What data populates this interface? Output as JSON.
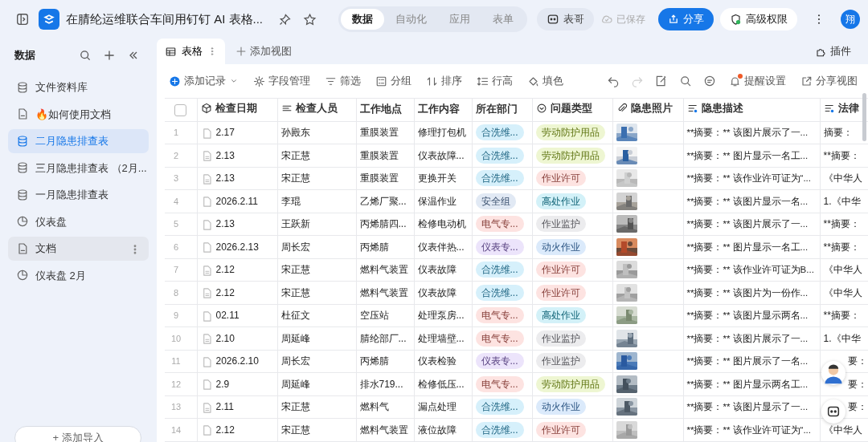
{
  "top_bar": {
    "title": "在腈纶运维联合车间用钉钉 AI 表格...",
    "mode_tabs": [
      {
        "label": "数据",
        "selected": true
      },
      {
        "label": "自动化",
        "selected": false
      },
      {
        "label": "应用",
        "selected": false
      },
      {
        "label": "表单",
        "selected": false
      }
    ],
    "assistant_button": "表哥",
    "save_status": "已保存",
    "share_button": "分享",
    "permission_button": "高级权限",
    "user_avatar": "翔"
  },
  "sidebar": {
    "heading": "数据",
    "items": [
      {
        "label": "文件资料库",
        "kind": "table",
        "selected": false,
        "hovered": false
      },
      {
        "label": "🔥如何使用文档",
        "kind": "doc",
        "selected": false,
        "hovered": false
      },
      {
        "label": "二月隐患排查表",
        "kind": "table",
        "selected": true,
        "hovered": false
      },
      {
        "label": "三月隐患排查表 （2月...",
        "kind": "table",
        "selected": false,
        "hovered": false
      },
      {
        "label": "一月隐患排查表",
        "kind": "table",
        "selected": false,
        "hovered": false
      },
      {
        "label": "仪表盘",
        "kind": "dashboard",
        "selected": false,
        "hovered": false
      },
      {
        "label": "文档",
        "kind": "doc",
        "selected": false,
        "hovered": true
      },
      {
        "label": "仪表盘 2月",
        "kind": "dashboard",
        "selected": false,
        "hovered": false
      }
    ],
    "add_button": "+ 添加导入"
  },
  "view_tabs": [
    {
      "label": "表格",
      "selected": true
    }
  ],
  "add_view_button": "添加视图",
  "plugin_button": "插件",
  "toolbar": {
    "left": [
      {
        "label": "添加记录",
        "kind": "add"
      },
      {
        "label": "字段管理",
        "kind": "fields"
      },
      {
        "label": "筛选",
        "kind": "filter"
      },
      {
        "label": "分组",
        "kind": "group"
      },
      {
        "label": "排序",
        "kind": "sort"
      },
      {
        "label": "行高",
        "kind": "row_height"
      },
      {
        "label": "填色",
        "kind": "fill"
      }
    ],
    "right_icons": [
      {
        "kind": "undo",
        "disabled": false
      },
      {
        "kind": "redo",
        "disabled": true
      },
      {
        "kind": "edit",
        "disabled": false
      },
      {
        "kind": "search",
        "disabled": false
      },
      {
        "kind": "comment",
        "disabled": false
      }
    ],
    "reminder_button": {
      "label": "提醒设置",
      "badge": true
    },
    "share_view_button": "分享视图"
  },
  "table": {
    "select_all": {
      "checked": false
    },
    "columns": [
      {
        "label": "检查日期",
        "kind": "date"
      },
      {
        "label": "检查人员",
        "kind": "text"
      },
      {
        "label": "工作地点",
        "kind": "plain"
      },
      {
        "label": "工作内容",
        "kind": "plain"
      },
      {
        "label": "所在部门",
        "kind": "plain"
      },
      {
        "label": "问题类型",
        "kind": "select"
      },
      {
        "label": "隐患照片",
        "kind": "attachment"
      },
      {
        "label": "隐患描述",
        "kind": "ai_text"
      },
      {
        "label": "法律",
        "kind": "ai_text"
      }
    ],
    "rows": [
      {
        "number": "1",
        "date": {
          "text": "2.17",
          "has_doc": false
        },
        "person": "孙殿东",
        "location": "重膜装置",
        "content": "修理打包机",
        "department": {
          "label": "合洗维...",
          "color": "#d6f0fb"
        },
        "issue_type": {
          "label": "劳动防护用品",
          "color": "#eef6d2"
        },
        "description": "**摘要：** 该图片展示了一...",
        "law": {
          "text": "摘要：",
          "covered": false
        }
      },
      {
        "number": "2",
        "date": {
          "text": "2.13",
          "has_doc": true
        },
        "person": "宋正慧",
        "location": "重膜装置",
        "content": "仪表故障...",
        "department": {
          "label": "合洗维...",
          "color": "#d6f0fb"
        },
        "issue_type": {
          "label": "劳动防护用品",
          "color": "#eef6d2"
        },
        "description": "**摘要：** 图片显示一名工...",
        "law": {
          "text": "**摘要：",
          "covered": false
        }
      },
      {
        "number": "3",
        "date": {
          "text": "2.13",
          "has_doc": true
        },
        "person": "宋正慧",
        "location": "重膜装置",
        "content": "更换开关",
        "department": {
          "label": "合洗维...",
          "color": "#d6f0fb"
        },
        "issue_type": {
          "label": "作业许可",
          "color": "#fde3e1"
        },
        "description": "**摘要：** 该作业许可证为“...",
        "law": {
          "text": "《中华人",
          "covered": false
        }
      },
      {
        "number": "4",
        "date": {
          "text": "2026.2.11",
          "has_doc": false
        },
        "person": "李琨",
        "location": "乙烯厂聚...",
        "content": "保温作业",
        "department": {
          "label": "安全组",
          "color": "#e1e9f4"
        },
        "issue_type": {
          "label": "高处作业",
          "color": "#d3f1f8"
        },
        "description": "**摘要：** 该图片显示一名...",
        "law": {
          "text": "1.《中华",
          "covered": false
        }
      },
      {
        "number": "5",
        "date": {
          "text": "2.13",
          "has_doc": false
        },
        "person": "王跃新",
        "location": "丙烯腈四...",
        "content": "检修电动机",
        "department": {
          "label": "电气专...",
          "color": "#fde3e1"
        },
        "issue_type": {
          "label": "作业监护",
          "color": "#ececee"
        },
        "description": "**摘要：** 该图片展示了一...",
        "law": {
          "text": "**摘要：",
          "covered": false
        }
      },
      {
        "number": "6",
        "date": {
          "text": "2026.2.13",
          "has_doc": false
        },
        "person": "周长宏",
        "location": "丙烯腈",
        "content": "仪表伴热...",
        "department": {
          "label": "仪表专...",
          "color": "#ece4fb"
        },
        "issue_type": {
          "label": "动火作业",
          "color": "#dbeafb"
        },
        "description": "**摘要：** 图片显示一名工...",
        "law": {
          "text": "**摘要：",
          "covered": false
        }
      },
      {
        "number": "7",
        "date": {
          "text": "2.12",
          "has_doc": true
        },
        "person": "宋正慧",
        "location": "燃料气装置",
        "content": "仪表故障",
        "department": {
          "label": "合洗维...",
          "color": "#d6f0fb"
        },
        "issue_type": {
          "label": "作业许可",
          "color": "#fde3e1"
        },
        "description": "**摘要：** 该作业许可证为B...",
        "law": {
          "text": "《中华人",
          "covered": false
        }
      },
      {
        "number": "8",
        "date": {
          "text": "2.12",
          "has_doc": true
        },
        "person": "宋正慧",
        "location": "燃料气装置",
        "content": "仪表故障",
        "department": {
          "label": "合洗维...",
          "color": "#d6f0fb"
        },
        "issue_type": {
          "label": "作业许可",
          "color": "#fde3e1"
        },
        "description": "**摘要：** 该图片为一份作...",
        "law": {
          "text": "《中华人",
          "covered": false
        }
      },
      {
        "number": "9",
        "date": {
          "text": "02.11",
          "has_doc": false
        },
        "person": "杜征文",
        "location": "空压站",
        "content": "处理泵房...",
        "department": {
          "label": "电气专...",
          "color": "#fde3e1"
        },
        "issue_type": {
          "label": "高处作业",
          "color": "#d3f1f8"
        },
        "description": "**摘要：** 该图片显示两名...",
        "law": {
          "text": "**摘要：",
          "covered": false
        }
      },
      {
        "number": "10",
        "date": {
          "text": "2.10",
          "has_doc": true
        },
        "person": "周延峰",
        "location": "腈纶部厂...",
        "content": "处理墙壁...",
        "department": {
          "label": "电气专...",
          "color": "#fde3e1"
        },
        "issue_type": {
          "label": "作业监护",
          "color": "#ececee"
        },
        "description": "**摘要：** 该图片展示了一...",
        "law": {
          "text": "1.《中华",
          "covered": false
        }
      },
      {
        "number": "11",
        "date": {
          "text": "2026.2.10",
          "has_doc": false
        },
        "person": "周长宏",
        "location": "丙烯腈",
        "content": "仪表检验",
        "department": {
          "label": "仪表专...",
          "color": "#ece4fb"
        },
        "issue_type": {
          "label": "作业监护",
          "color": "#ececee"
        },
        "description": "**摘要：** 图片展示了一名...",
        "law": {
          "text": "要：",
          "covered": true
        }
      },
      {
        "number": "12",
        "date": {
          "text": "2.9",
          "has_doc": false
        },
        "person": "周延峰",
        "location": "排水719...",
        "content": "检修低压...",
        "department": {
          "label": "电气专...",
          "color": "#fde3e1"
        },
        "issue_type": {
          "label": "劳动防护用品",
          "color": "#eef6d2"
        },
        "description": "**摘要：** 图片显示两名工...",
        "law": {
          "text": "要：",
          "covered": true
        }
      },
      {
        "number": "13",
        "date": {
          "text": "2.11",
          "has_doc": true
        },
        "person": "宋正慧",
        "location": "燃料气",
        "content": "漏点处理",
        "department": {
          "label": "合洗维...",
          "color": "#d6f0fb"
        },
        "issue_type": {
          "label": "动火作业",
          "color": "#dbeafb"
        },
        "description": "**摘要：** 该图片显示了一...",
        "law": {
          "text": "要：",
          "covered": true
        }
      },
      {
        "number": "14",
        "date": {
          "text": "2.12",
          "has_doc": false
        },
        "person": "宋正慧",
        "location": "燃料气装置",
        "content": "液位故障",
        "department": {
          "label": "合洗维...",
          "color": "#d6f0fb"
        },
        "issue_type": {
          "label": "作业许可",
          "color": "#fde3e1"
        },
        "description": "**摘要：** 该作业许可证为“...",
        "law": {
          "text": "《中华人",
          "covered": false
        }
      }
    ]
  }
}
